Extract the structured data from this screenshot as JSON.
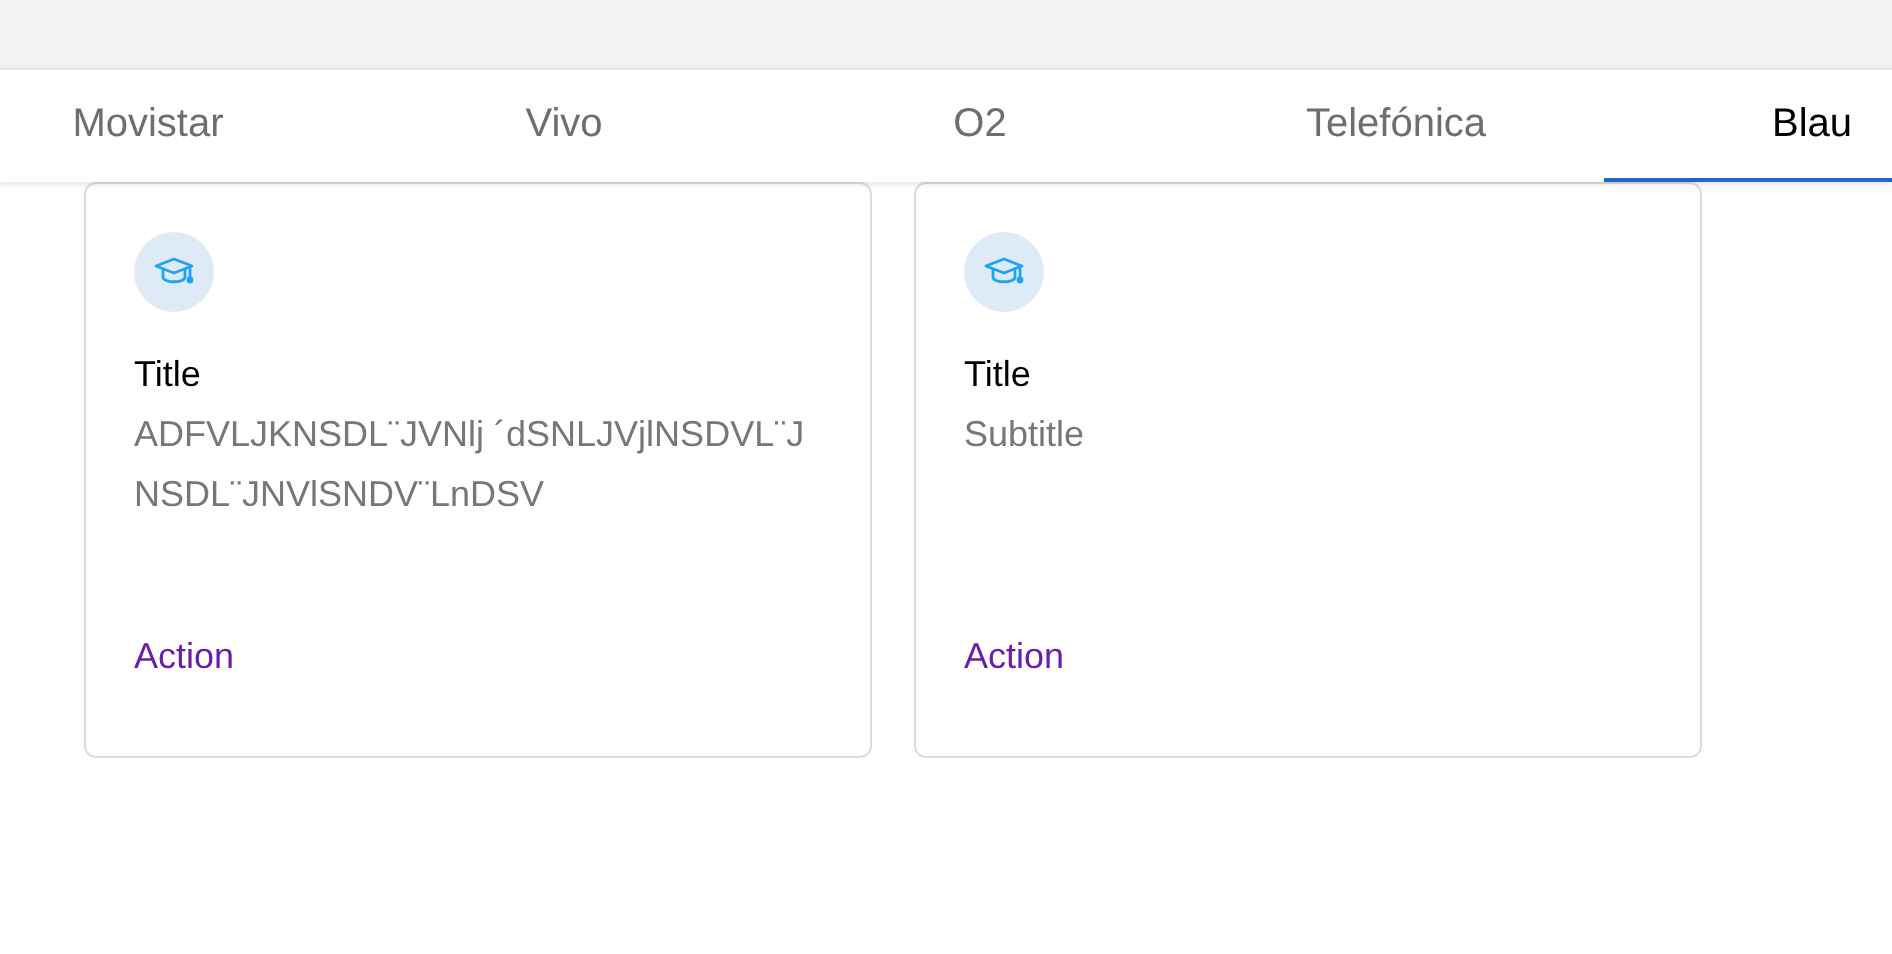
{
  "tabs": [
    {
      "label": "Movistar",
      "selected": false
    },
    {
      "label": "Vivo",
      "selected": false
    },
    {
      "label": "O2",
      "selected": false
    },
    {
      "label": "Telefónica",
      "selected": false
    },
    {
      "label": "Blau",
      "selected": true
    }
  ],
  "cards": [
    {
      "title": "Title",
      "subtitle": "ADFVLJKNSDL¨JVNlj ´dSNLJVjlNSDVL¨JNSDL¨JNVlSNDV¨LnDSV",
      "action": "Action"
    },
    {
      "title": "Title",
      "subtitle": "Subtitle",
      "action": "Action"
    }
  ]
}
